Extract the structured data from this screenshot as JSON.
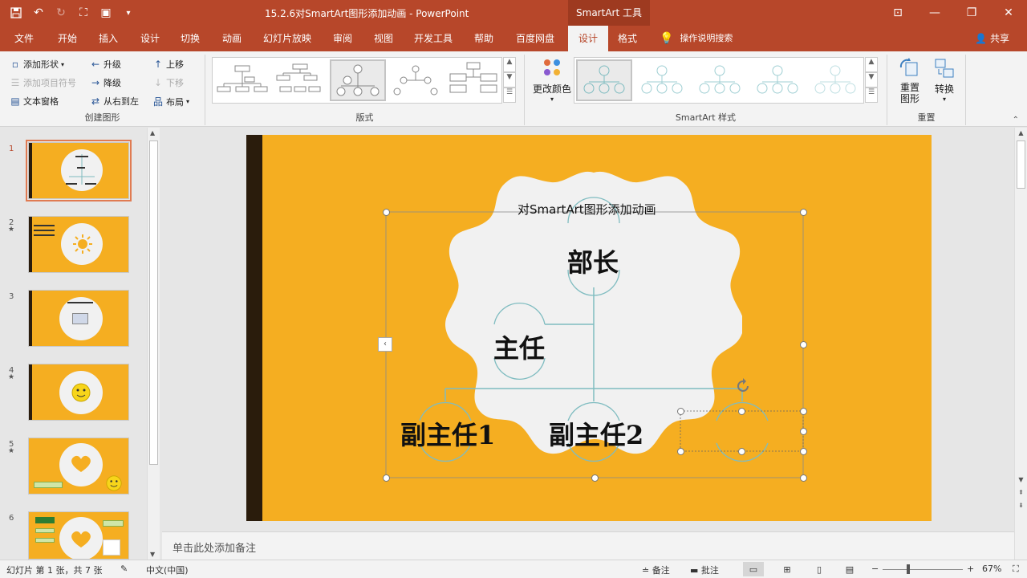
{
  "window": {
    "doc_title": "15.2.6对SmartArt图形添加动画  -  PowerPoint",
    "context_title": "SmartArt 工具"
  },
  "tabs": [
    "文件",
    "开始",
    "插入",
    "设计",
    "切换",
    "动画",
    "幻灯片放映",
    "审阅",
    "视图",
    "开发工具",
    "帮助",
    "百度网盘",
    "设计",
    "格式"
  ],
  "tell_me": "操作说明搜索",
  "share": "共享",
  "ribbon": {
    "create_graphic": {
      "label": "创建图形",
      "add_shape": "添加形状",
      "add_bullet": "添加项目符号",
      "text_pane": "文本窗格",
      "promote": "升级",
      "demote": "降级",
      "rtl": "从右到左",
      "move_up": "上移",
      "move_down": "下移",
      "layout": "布局"
    },
    "layouts": {
      "label": "版式"
    },
    "styles": {
      "label": "SmartArt 样式",
      "change_colors": "更改颜色"
    },
    "reset": {
      "label": "重置",
      "reset_graphic": "重置\n图形",
      "convert": "转换"
    }
  },
  "slides": [
    {
      "num": "1",
      "active": true,
      "star": false
    },
    {
      "num": "2",
      "active": false,
      "star": true
    },
    {
      "num": "3",
      "active": false,
      "star": false
    },
    {
      "num": "4",
      "active": false,
      "star": true
    },
    {
      "num": "5",
      "active": false,
      "star": true
    },
    {
      "num": "6",
      "active": false,
      "star": false
    }
  ],
  "slide": {
    "smartart_title": "对SmartArt图形添加动画",
    "node_top": "部长",
    "node_mid": "主任",
    "node_left": "副主任1",
    "node_center": "副主任2"
  },
  "notes_placeholder": "单击此处添加备注",
  "status": {
    "slide_info": "幻灯片 第 1 张，共 7 张",
    "language": "中文(中国)",
    "notes": "备注",
    "comments": "批注",
    "zoom": "67%"
  },
  "colors": {
    "brand": "#b7472a",
    "slide_bg": "#f5ae21",
    "dark_bar": "#2a1c0c",
    "node_line": "#7fbcc0"
  }
}
